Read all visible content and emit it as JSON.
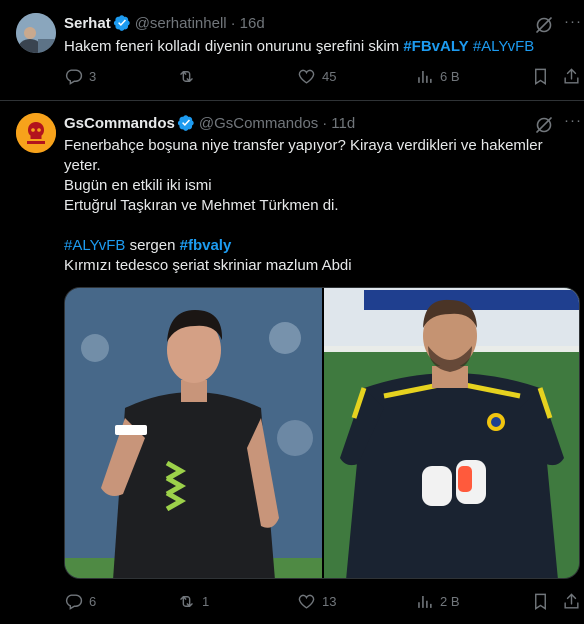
{
  "tweets": [
    {
      "author": {
        "name": "Serhat",
        "handle": "@serhatinhell",
        "time": "16d",
        "verified": true
      },
      "text_parts": [
        {
          "text": "Hakem feneri kolladı diyenin onurunu şerefini skim ",
          "link": false
        },
        {
          "text": "#FBvALY",
          "link": true,
          "bold": true
        },
        {
          "text": " ",
          "link": false
        },
        {
          "text": "#ALYvFB",
          "link": true,
          "bold": false
        }
      ],
      "actions": {
        "replies": "3",
        "reposts": "",
        "likes": "45",
        "views": "6 B"
      }
    },
    {
      "author": {
        "name": "GsCommandos",
        "handle": "@GsCommandos",
        "time": "11d",
        "verified": true
      },
      "lines": [
        "Fenerbahçe boşuna niye transfer yapıyor? Kiraya verdikleri ve hakemler",
        "yeter.",
        "Bugün en etkili iki ismi",
        "Ertuğrul Taşkıran ve Mehmet Türkmen di.",
        "",
        "Kırmızı tedesco şeriat skriniar mazlum Abdi"
      ],
      "tag_line": {
        "tag1": "#ALYvFB",
        "middle": " sergen ",
        "tag2": "#fbvaly"
      },
      "actions": {
        "replies": "6",
        "reposts": "1",
        "likes": "13",
        "views": "2 B"
      }
    }
  ],
  "colors": {
    "background": "#000000",
    "text": "#e7e9ea",
    "muted": "#71767b",
    "link": "#1d9bf0",
    "verified": "#1d9bf0",
    "divider": "#2f3336"
  },
  "icons": [
    "verified-badge-icon",
    "grok-icon",
    "more-icon",
    "reply-icon",
    "repost-icon",
    "like-icon",
    "views-icon",
    "bookmark-icon",
    "share-icon"
  ]
}
